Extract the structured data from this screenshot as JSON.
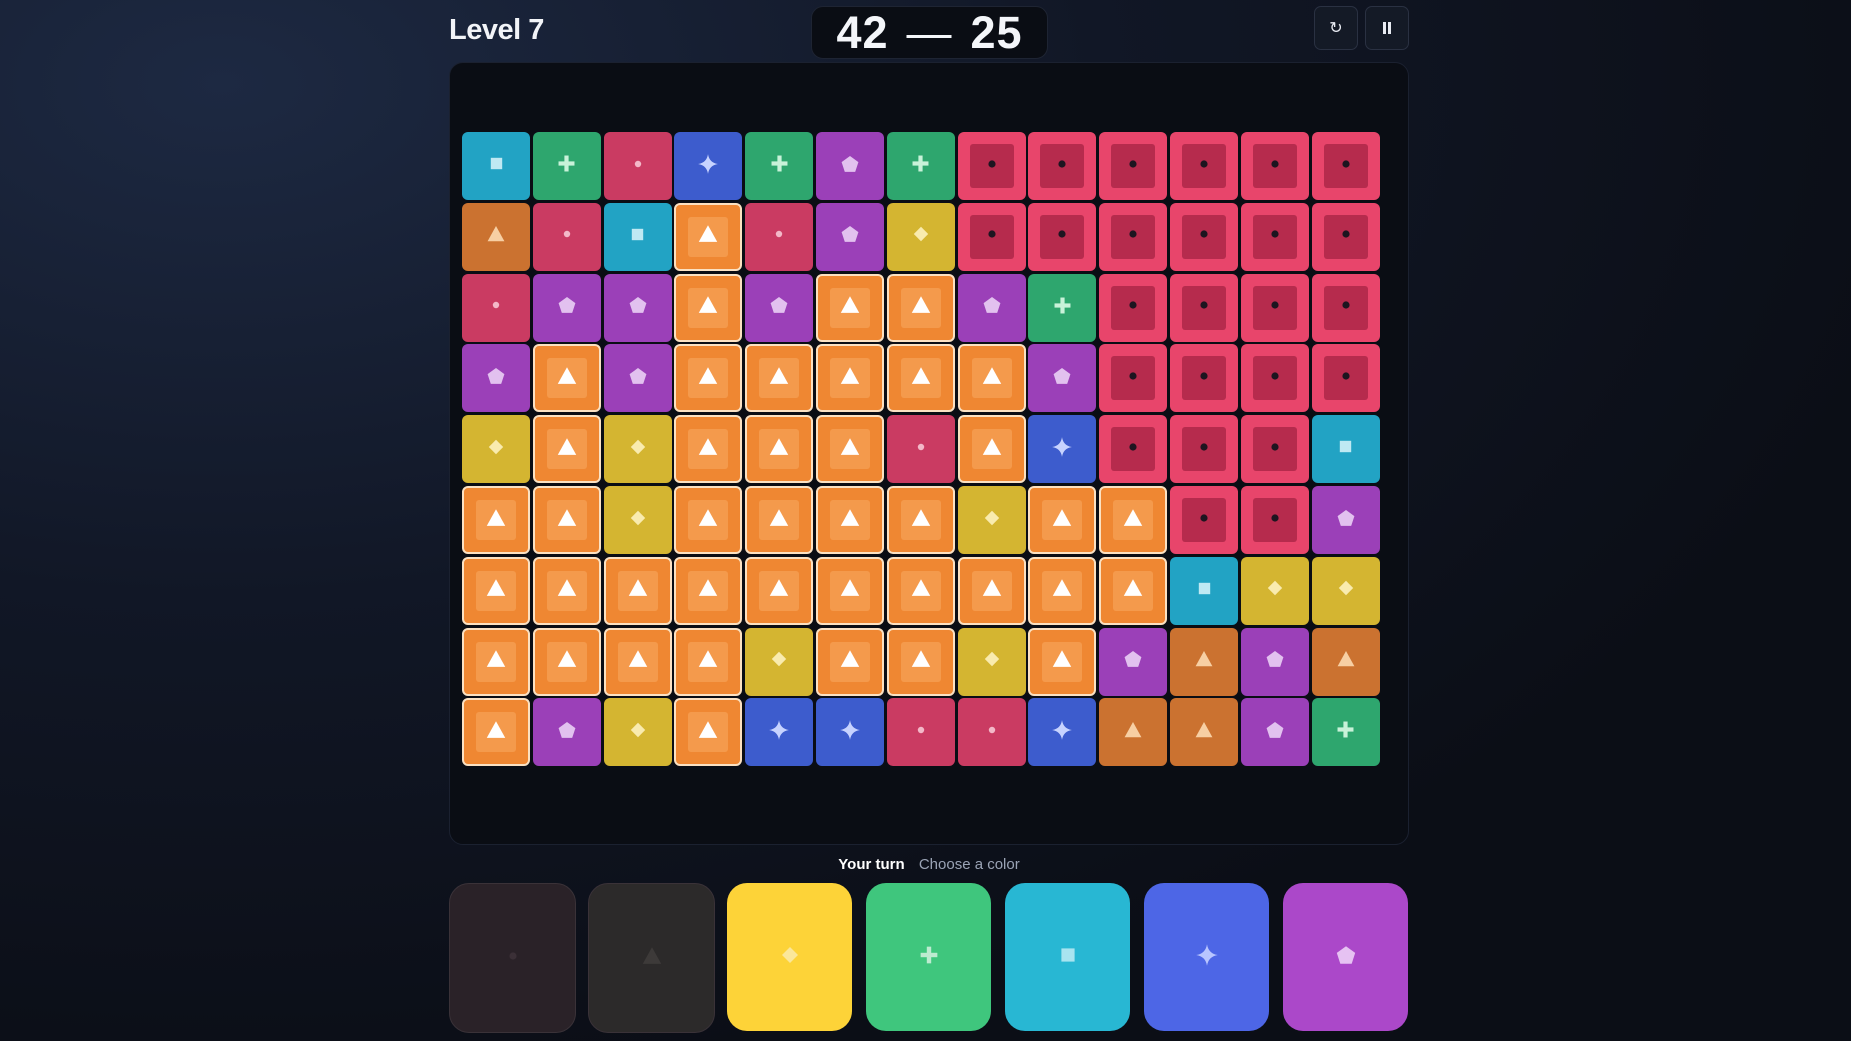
{
  "header": {
    "level": "Level 7",
    "score_player": "42",
    "score_dash": "—",
    "score_opponent": "25",
    "restart_icon": "↻",
    "pause_icon": "⏸"
  },
  "status": {
    "turn": "Your turn",
    "hint": "Choose a color"
  },
  "colors": {
    "cyan": "#22a3c4",
    "green": "#2ea66e",
    "crimson": "#ca3b62",
    "blue": "#3d5ccd",
    "purple": "#9b40b8",
    "orange_dark": "#cb7230",
    "yellow": "#d4b531",
    "orange_flood": "#ef8732",
    "red_frame": "#e8456b",
    "red_inner": "#b62b4d"
  },
  "board": {
    "legend": {
      "C": "cyan-square",
      "G": "green-plus",
      "R": "crimson-dot",
      "B": "blue-star",
      "P": "purple-pentagon",
      "O": "orange-triangle",
      "Y": "yellow-diamond",
      "F": "player-flood-orange-triangle",
      "X": "opponent-territory-red-dot"
    },
    "rows": [
      [
        "C",
        "G",
        "R",
        "B",
        "G",
        "P",
        "G",
        "X",
        "X",
        "X",
        "X",
        "X",
        "X"
      ],
      [
        "O",
        "R",
        "C",
        "F",
        "R",
        "P",
        "Y",
        "X",
        "X",
        "X",
        "X",
        "X",
        "X"
      ],
      [
        "R",
        "P",
        "P",
        "F",
        "P",
        "F",
        "F",
        "P",
        "G",
        "X",
        "X",
        "X",
        "X"
      ],
      [
        "P",
        "F",
        "P",
        "F",
        "F",
        "F",
        "F",
        "F",
        "P",
        "X",
        "X",
        "X",
        "X"
      ],
      [
        "Y",
        "F",
        "Y",
        "F",
        "F",
        "F",
        "R",
        "F",
        "B",
        "X",
        "X",
        "X",
        "C"
      ],
      [
        "F",
        "F",
        "Y",
        "F",
        "F",
        "F",
        "F",
        "Y",
        "F",
        "F",
        "X",
        "X",
        "P"
      ],
      [
        "F",
        "F",
        "F",
        "F",
        "F",
        "F",
        "F",
        "F",
        "F",
        "F",
        "C",
        "Y",
        "Y"
      ],
      [
        "F",
        "F",
        "F",
        "F",
        "Y",
        "F",
        "F",
        "Y",
        "F",
        "P",
        "O",
        "P",
        "O"
      ],
      [
        "F",
        "P",
        "Y",
        "F",
        "B",
        "B",
        "R",
        "R",
        "B",
        "O",
        "O",
        "P",
        "G"
      ]
    ]
  },
  "choices": [
    {
      "name": "crimson-dot",
      "color": "#2a2228",
      "icon": "dot-icon",
      "enabled": false
    },
    {
      "name": "orange-triangle",
      "color": "#2c2a2a",
      "icon": "triangle-icon",
      "enabled": false
    },
    {
      "name": "yellow-diamond",
      "color": "#fdd338",
      "icon": "diamond-icon",
      "enabled": true
    },
    {
      "name": "green-plus",
      "color": "#3fc67d",
      "icon": "plus-icon",
      "enabled": true
    },
    {
      "name": "cyan-square",
      "color": "#28b7d3",
      "icon": "square-icon",
      "enabled": true
    },
    {
      "name": "blue-star",
      "color": "#4d66e6",
      "icon": "star-icon",
      "enabled": true
    },
    {
      "name": "purple-pentagon",
      "color": "#ab48c9",
      "icon": "pentagon-icon",
      "enabled": true
    }
  ]
}
